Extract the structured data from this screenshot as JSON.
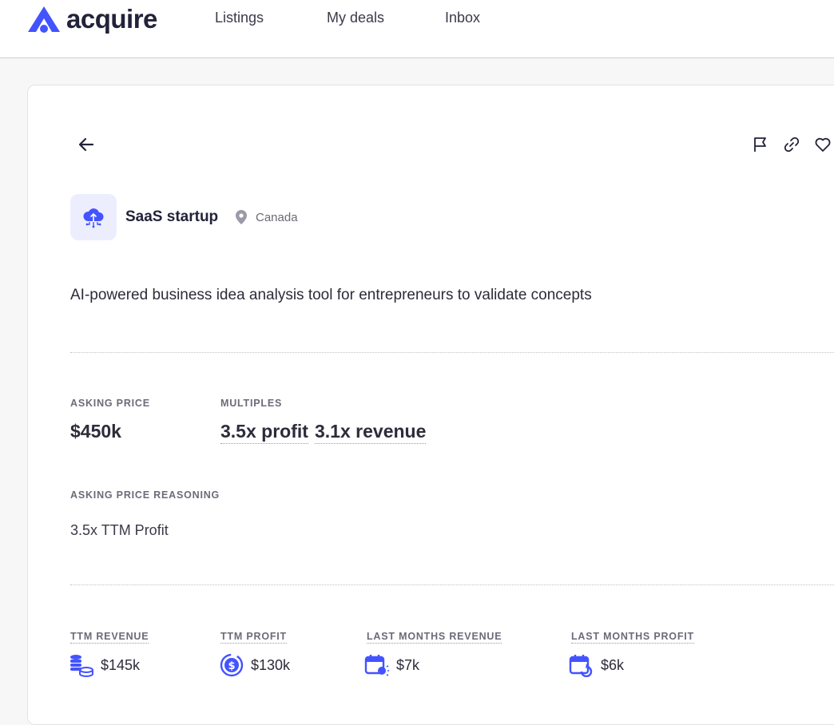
{
  "app": {
    "logo_text": "acquire",
    "brand_color": "#4353ff"
  },
  "nav": {
    "items": [
      "Listings",
      "My deals",
      "Inbox"
    ]
  },
  "listing": {
    "name": "SaaS startup",
    "location": "Canada",
    "description": "AI-powered business idea analysis tool for entrepreneurs to validate concepts",
    "asking_price_label": "ASKING PRICE",
    "asking_price": "$450k",
    "multiples_label": "MULTIPLES",
    "multiple_profit": "3.5x profit",
    "multiple_revenue": "3.1x revenue",
    "reasoning_label": "ASKING PRICE REASONING",
    "reasoning": "3.5x TTM Profit",
    "metrics": [
      {
        "label": "TTM REVENUE",
        "value": "$145k",
        "icon": "coins-stack-icon"
      },
      {
        "label": "TTM PROFIT",
        "value": "$130k",
        "icon": "dollar-cycle-icon"
      },
      {
        "label": "LAST MONTHS REVENUE",
        "value": "$7k",
        "icon": "calendar-revenue-icon"
      },
      {
        "label": "LAST MONTHS PROFIT",
        "value": "$6k",
        "icon": "calendar-profit-icon"
      }
    ]
  }
}
